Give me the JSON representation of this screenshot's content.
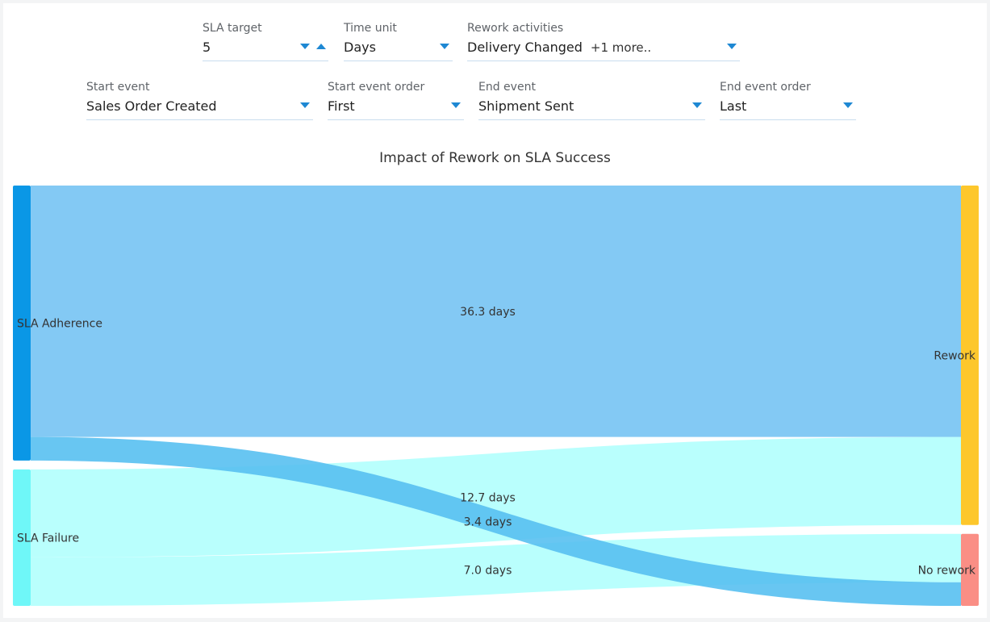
{
  "filters": {
    "sla_target": {
      "label": "SLA target",
      "value": "5"
    },
    "time_unit": {
      "label": "Time unit",
      "value": "Days"
    },
    "rework_activities": {
      "label": "Rework activities",
      "value": "Delivery Changed",
      "extra": "+1 more.."
    },
    "start_event": {
      "label": "Start event",
      "value": "Sales Order Created"
    },
    "start_event_order": {
      "label": "Start event order",
      "value": "First"
    },
    "end_event": {
      "label": "End event",
      "value": "Shipment Sent"
    },
    "end_event_order": {
      "label": "End event order",
      "value": "Last"
    }
  },
  "colors": {
    "accent": "#1e88d3",
    "sla_adherence": "#0a97e6",
    "sla_failure": "#6ff7f8",
    "rework": "#fdc72c",
    "no_rework": "#fa8e85",
    "link_adherence": "#83c9f4",
    "link_adherence_cross": "#58c0f1",
    "link_failure": "#b9fffd"
  },
  "chart_data": {
    "type": "sankey",
    "title": "Impact of Rework on SLA Success",
    "unit": "days",
    "nodes": [
      {
        "id": "sla_adherence",
        "name": "SLA Adherence"
      },
      {
        "id": "sla_failure",
        "name": "SLA Failure"
      },
      {
        "id": "rework",
        "name": "Rework"
      },
      {
        "id": "no_rework",
        "name": "No rework"
      }
    ],
    "links": [
      {
        "source": "sla_adherence",
        "target": "rework",
        "value": 36.3,
        "label": "36.3 days"
      },
      {
        "source": "sla_failure",
        "target": "rework",
        "value": 12.7,
        "label": "12.7 days"
      },
      {
        "source": "sla_adherence",
        "target": "no_rework",
        "value": 3.4,
        "label": "3.4 days"
      },
      {
        "source": "sla_failure",
        "target": "no_rework",
        "value": 7.0,
        "label": "7.0 days"
      }
    ]
  }
}
